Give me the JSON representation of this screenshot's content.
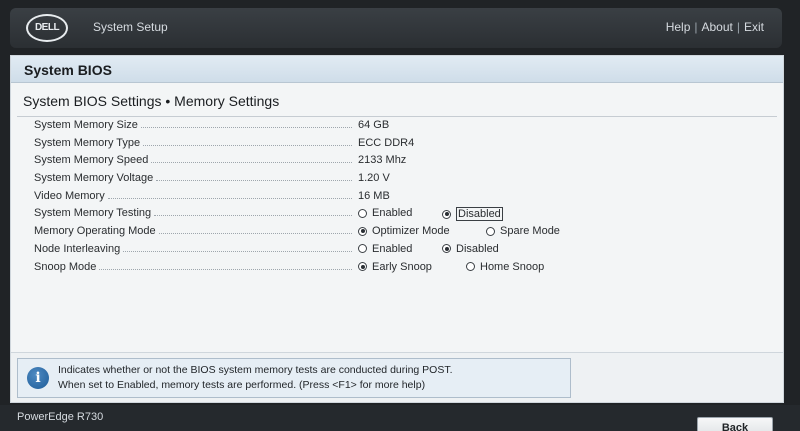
{
  "header": {
    "logo_text": "DELL",
    "app_title": "System Setup",
    "links": {
      "help": "Help",
      "about": "About",
      "exit": "Exit",
      "separator": "|"
    }
  },
  "panel": {
    "title": "System BIOS",
    "heading": "System BIOS Settings • Memory Settings"
  },
  "settings": [
    {
      "label": "System Memory Size",
      "value": "64 GB"
    },
    {
      "label": "System Memory Type",
      "value": "ECC DDR4"
    },
    {
      "label": "System Memory Speed",
      "value": "2133 Mhz"
    },
    {
      "label": "System Memory Voltage",
      "value": "1.20 V"
    },
    {
      "label": "Video Memory",
      "value": "16 MB"
    },
    {
      "label": "System Memory Testing",
      "options": [
        "Enabled",
        "Disabled"
      ],
      "selected": "Disabled",
      "focused": "Disabled"
    },
    {
      "label": "Memory Operating Mode",
      "options": [
        "Optimizer Mode",
        "Spare Mode"
      ],
      "selected": "Optimizer Mode"
    },
    {
      "label": "Node Interleaving",
      "options": [
        "Enabled",
        "Disabled"
      ],
      "selected": "Disabled"
    },
    {
      "label": "Snoop Mode",
      "options": [
        "Early Snoop",
        "Home Snoop"
      ],
      "selected": "Early Snoop"
    }
  ],
  "help": {
    "icon": "info-icon",
    "line1": "Indicates whether or not the BIOS system memory tests are conducted during POST.",
    "line2": "When set to Enabled, memory tests are performed. (Press <F1> for more help)"
  },
  "footer": {
    "model": "PowerEdge R730",
    "back_label": "Back"
  },
  "colors": {
    "header_bg": "#2b2f33",
    "panel_bg": "#f3f5f6",
    "title_bar": "#cfdde9",
    "info_blue": "#1d5c98"
  }
}
